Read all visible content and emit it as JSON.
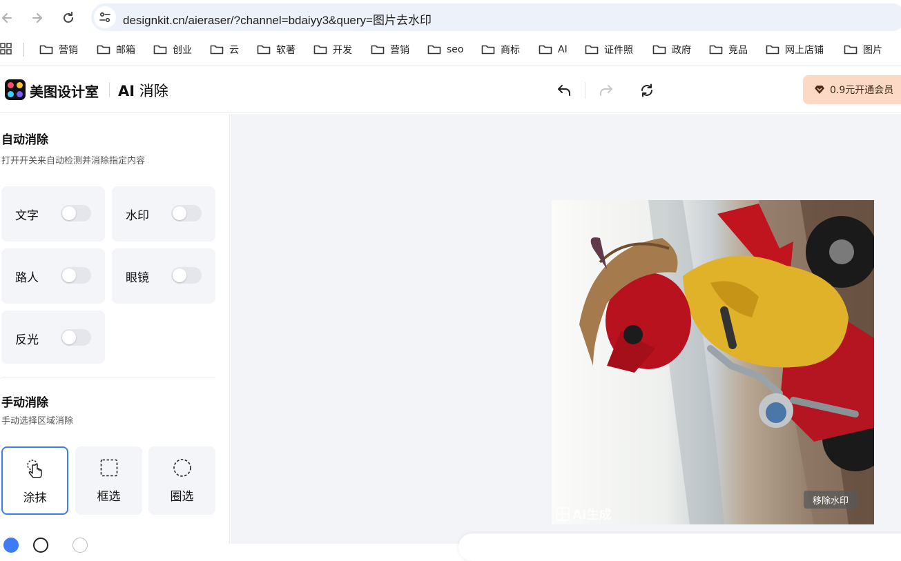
{
  "browser": {
    "url": "designkit.cn/aieraser/?channel=bdaiyy3&query=图片去水印",
    "bookmarks": [
      "营销",
      "邮箱",
      "创业",
      "云",
      "软著",
      "开发",
      "营销",
      "seo",
      "商标",
      "AI",
      "证件照",
      "政府",
      "竞品",
      "网上店铺",
      "图片"
    ]
  },
  "header": {
    "brand": "美图设计室",
    "product_ai": "AI",
    "product_name": "消除",
    "vip_label": "0.9元开通会员"
  },
  "auto": {
    "title": "自动消除",
    "desc": "打开开关来自动检测并消除指定内容",
    "toggles": [
      {
        "label": "文字",
        "on": false
      },
      {
        "label": "水印",
        "on": false
      },
      {
        "label": "路人",
        "on": false
      },
      {
        "label": "眼镜",
        "on": false
      },
      {
        "label": "反光",
        "on": false
      }
    ]
  },
  "manual": {
    "title": "手动消除",
    "desc": "手动选择区域消除",
    "tools": [
      {
        "label": "涂抹",
        "icon": "hand-pointer-icon",
        "active": true
      },
      {
        "label": "框选",
        "icon": "dashed-square-icon",
        "active": false
      },
      {
        "label": "圈选",
        "icon": "dashed-circle-icon",
        "active": false
      }
    ]
  },
  "canvas": {
    "remove_watermark": "移除水印",
    "ai_watermark": "AI生成"
  },
  "colors": {
    "accent": "#3d7bf7",
    "vip_bg": "#fbd9c4",
    "card_bg": "#f4f5f8",
    "canvas_bg": "#f3f4f8"
  }
}
